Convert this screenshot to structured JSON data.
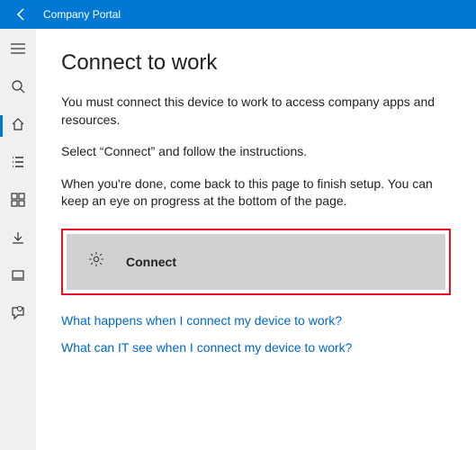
{
  "titlebar": {
    "title": "Company Portal"
  },
  "sidebar": {
    "items": [
      {
        "name": "menu"
      },
      {
        "name": "search"
      },
      {
        "name": "home"
      },
      {
        "name": "list"
      },
      {
        "name": "apps"
      },
      {
        "name": "download"
      },
      {
        "name": "device"
      },
      {
        "name": "feedback"
      }
    ]
  },
  "page": {
    "title": "Connect to work",
    "para1": "You must connect this device to work to access company apps and resources.",
    "para2": "Select “Connect” and follow the instructions.",
    "para3": "When you're done, come back to this page to finish setup. You can keep an eye on progress at the bottom of the page.",
    "connect_label": "Connect",
    "link1": "What happens when I connect my device to work?",
    "link2": "What can IT see when I connect my device to work?"
  }
}
